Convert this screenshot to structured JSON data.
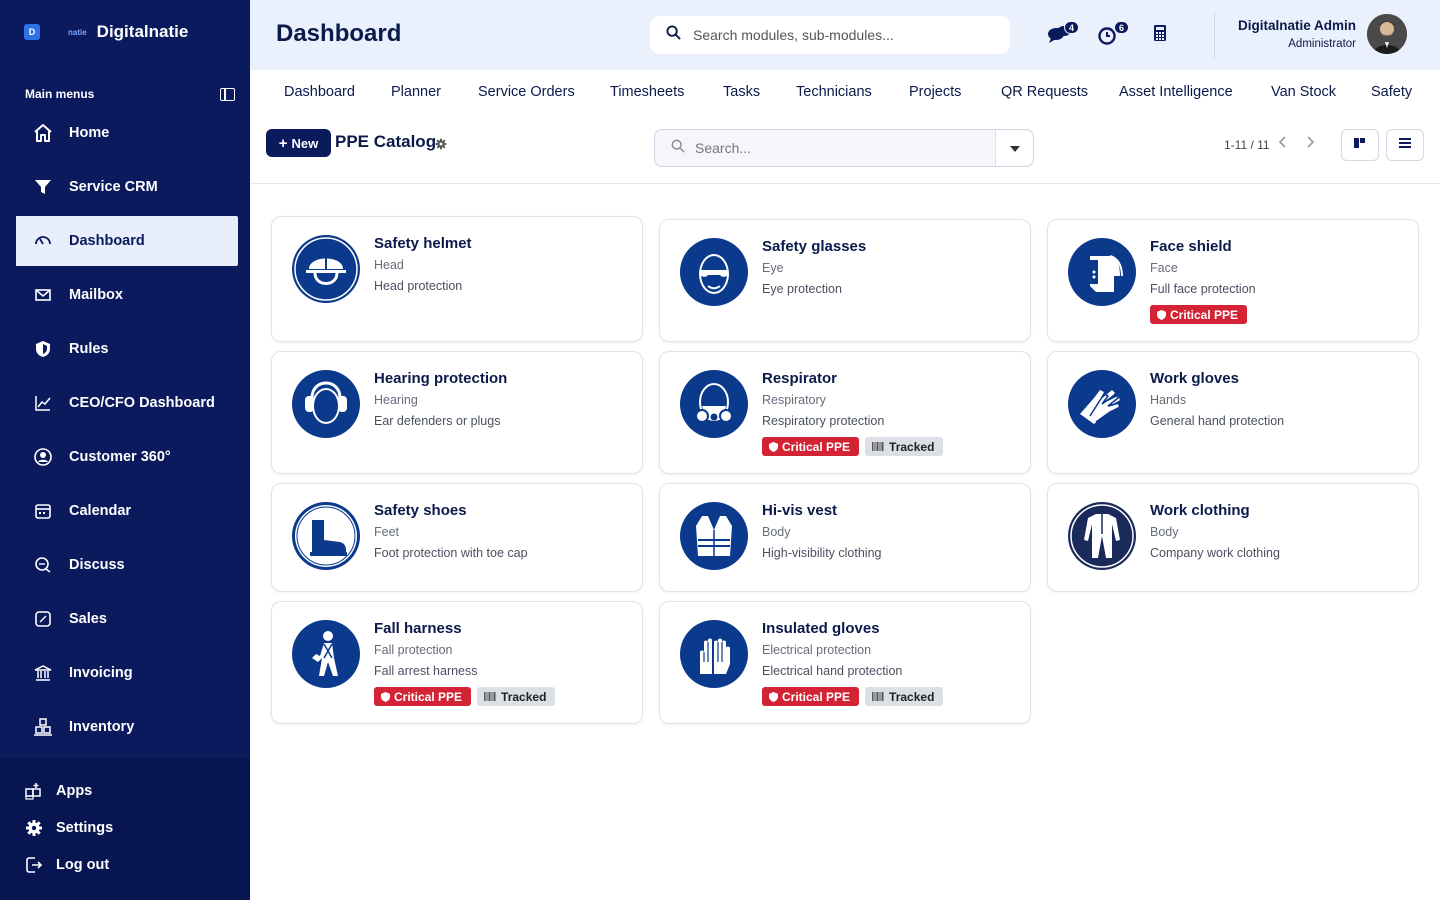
{
  "brand": {
    "logo_letter": "D",
    "small_text": "natie",
    "name": "Digitalnatie"
  },
  "sidebar": {
    "section_label": "Main menus",
    "items": [
      {
        "label": "Home",
        "icon": "home-icon"
      },
      {
        "label": "Service CRM",
        "icon": "funnel-icon"
      },
      {
        "label": "Dashboard",
        "icon": "gauge-icon",
        "active": true
      },
      {
        "label": "Mailbox",
        "icon": "mail-icon"
      },
      {
        "label": "Rules",
        "icon": "shield-icon"
      },
      {
        "label": "CEO/CFO Dashboard",
        "icon": "chart-line-icon"
      },
      {
        "label": "Customer 360°",
        "icon": "user-circle-icon"
      },
      {
        "label": "Calendar",
        "icon": "calendar-icon"
      },
      {
        "label": "Discuss",
        "icon": "chat-icon"
      },
      {
        "label": "Sales",
        "icon": "percent-icon"
      },
      {
        "label": "Invoicing",
        "icon": "bank-icon"
      },
      {
        "label": "Inventory",
        "icon": "boxes-icon"
      }
    ],
    "bottom": [
      {
        "label": "Apps",
        "icon": "apps-icon"
      },
      {
        "label": "Settings",
        "icon": "gear-icon"
      },
      {
        "label": "Log out",
        "icon": "logout-icon"
      }
    ]
  },
  "header": {
    "title": "Dashboard",
    "search_placeholder": "Search modules, sub-modules...",
    "notifications": [
      {
        "icon": "chat-bubbles-icon",
        "count": "4"
      },
      {
        "icon": "activity-clock-icon",
        "count": "6"
      },
      {
        "icon": "calculator-icon",
        "count": ""
      }
    ],
    "user": {
      "name": "Digitalnatie Admin",
      "role": "Administrator"
    }
  },
  "tabs": [
    "Dashboard",
    "Planner",
    "Service Orders",
    "Timesheets",
    "Tasks",
    "Technicians",
    "Projects",
    "QR Requests",
    "Asset Intelligence",
    "Van Stock",
    "Safety"
  ],
  "toolbar": {
    "new_label": "New",
    "title": "PPE Catalog",
    "search_placeholder": "Search...",
    "pager": "1-11 / 11"
  },
  "colors": {
    "sidebar": "#0a1a5c",
    "accent": "#0b3a8c",
    "critical": "#d32335",
    "tracked": "#dcdfe5"
  },
  "tag_labels": {
    "critical": "Critical PPE",
    "tracked": "Tracked"
  },
  "cards": [
    {
      "title": "Safety helmet",
      "category": "Head",
      "description": "Head protection",
      "critical": false,
      "tracked": false,
      "icon": "helmet-icon"
    },
    {
      "title": "Safety glasses",
      "category": "Eye",
      "description": "Eye protection",
      "critical": false,
      "tracked": false,
      "icon": "glasses-icon"
    },
    {
      "title": "Face shield",
      "category": "Face",
      "description": "Full face protection",
      "critical": true,
      "tracked": false,
      "icon": "face-shield-icon"
    },
    {
      "title": "Hearing protection",
      "category": "Hearing",
      "description": "Ear defenders or plugs",
      "critical": false,
      "tracked": false,
      "icon": "ear-defenders-icon"
    },
    {
      "title": "Respirator",
      "category": "Respiratory",
      "description": "Respiratory protection",
      "critical": true,
      "tracked": true,
      "icon": "respirator-icon"
    },
    {
      "title": "Work gloves",
      "category": "Hands",
      "description": "General hand protection",
      "critical": false,
      "tracked": false,
      "icon": "gloves-icon"
    },
    {
      "title": "Safety shoes",
      "category": "Feet",
      "description": "Foot protection with toe cap",
      "critical": false,
      "tracked": false,
      "icon": "boot-icon"
    },
    {
      "title": "Hi-vis vest",
      "category": "Body",
      "description": "High-visibility clothing",
      "critical": false,
      "tracked": false,
      "icon": "vest-icon"
    },
    {
      "title": "Work clothing",
      "category": "Body",
      "description": "Company work clothing",
      "critical": false,
      "tracked": false,
      "icon": "overall-icon"
    },
    {
      "title": "Fall harness",
      "category": "Fall protection",
      "description": "Fall arrest harness",
      "critical": true,
      "tracked": true,
      "icon": "harness-icon"
    },
    {
      "title": "Insulated gloves",
      "category": "Electrical protection",
      "description": "Electrical hand protection",
      "critical": true,
      "tracked": true,
      "icon": "insulated-gloves-icon"
    }
  ]
}
